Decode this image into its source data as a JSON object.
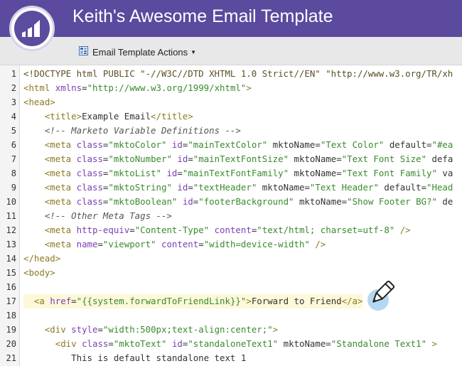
{
  "header": {
    "title": "Keith's Awesome Email Template",
    "logo_icon": "marketo-logo-icon"
  },
  "toolbar": {
    "actions_label": "Email Template Actions",
    "actions_icon": "template-grid-icon"
  },
  "editor": {
    "highlighted_line": 17,
    "lines": [
      {
        "n": "1",
        "tokens": [
          [
            "decl",
            "<!DOCTYPE html PUBLIC \"-//W3C//DTD XHTML 1.0 Strict//EN\" \"http://www.w3.org/TR/xh"
          ]
        ]
      },
      {
        "n": "2",
        "tokens": [
          [
            "tag",
            "<html "
          ],
          [
            "attr",
            "xmlns"
          ],
          [
            "txt",
            "="
          ],
          [
            "val",
            "\"http://www.w3.org/1999/xhtml\""
          ],
          [
            "tag",
            ">"
          ]
        ]
      },
      {
        "n": "3",
        "tokens": [
          [
            "tag",
            "<head>"
          ]
        ]
      },
      {
        "n": "4",
        "tokens": [
          [
            "txt",
            "    "
          ],
          [
            "tag",
            "<title>"
          ],
          [
            "txt",
            "Example Email"
          ],
          [
            "tag",
            "</title>"
          ]
        ]
      },
      {
        "n": "5",
        "tokens": [
          [
            "txt",
            "    "
          ],
          [
            "comment",
            "<!-- Marketo Variable Definitions -->"
          ]
        ]
      },
      {
        "n": "6",
        "tokens": [
          [
            "txt",
            "    "
          ],
          [
            "tag",
            "<meta "
          ],
          [
            "attr",
            "class"
          ],
          [
            "txt",
            "="
          ],
          [
            "val",
            "\"mktoColor\""
          ],
          [
            "txt",
            " "
          ],
          [
            "attr",
            "id"
          ],
          [
            "txt",
            "="
          ],
          [
            "val",
            "\"mainTextColor\""
          ],
          [
            "txt",
            " mktoName="
          ],
          [
            "val",
            "\"Text Color\""
          ],
          [
            "txt",
            " default="
          ],
          [
            "val",
            "\"#ea"
          ]
        ]
      },
      {
        "n": "7",
        "tokens": [
          [
            "txt",
            "    "
          ],
          [
            "tag",
            "<meta "
          ],
          [
            "attr",
            "class"
          ],
          [
            "txt",
            "="
          ],
          [
            "val",
            "\"mktoNumber\""
          ],
          [
            "txt",
            " "
          ],
          [
            "attr",
            "id"
          ],
          [
            "txt",
            "="
          ],
          [
            "val",
            "\"mainTextFontSize\""
          ],
          [
            "txt",
            " mktoName="
          ],
          [
            "val",
            "\"Text Font Size\""
          ],
          [
            "txt",
            " defa"
          ]
        ]
      },
      {
        "n": "8",
        "tokens": [
          [
            "txt",
            "    "
          ],
          [
            "tag",
            "<meta "
          ],
          [
            "attr",
            "class"
          ],
          [
            "txt",
            "="
          ],
          [
            "val",
            "\"mktoList\""
          ],
          [
            "txt",
            " "
          ],
          [
            "attr",
            "id"
          ],
          [
            "txt",
            "="
          ],
          [
            "val",
            "\"mainTextFontFamily\""
          ],
          [
            "txt",
            " mktoName="
          ],
          [
            "val",
            "\"Text Font Family\""
          ],
          [
            "txt",
            " va"
          ]
        ]
      },
      {
        "n": "9",
        "tokens": [
          [
            "txt",
            "    "
          ],
          [
            "tag",
            "<meta "
          ],
          [
            "attr",
            "class"
          ],
          [
            "txt",
            "="
          ],
          [
            "val",
            "\"mktoString\""
          ],
          [
            "txt",
            " "
          ],
          [
            "attr",
            "id"
          ],
          [
            "txt",
            "="
          ],
          [
            "val",
            "\"textHeader\""
          ],
          [
            "txt",
            " mktoName="
          ],
          [
            "val",
            "\"Text Header\""
          ],
          [
            "txt",
            " default="
          ],
          [
            "val",
            "\"Head"
          ]
        ]
      },
      {
        "n": "10",
        "tokens": [
          [
            "txt",
            "    "
          ],
          [
            "tag",
            "<meta "
          ],
          [
            "attr",
            "class"
          ],
          [
            "txt",
            "="
          ],
          [
            "val",
            "\"mktoBoolean\""
          ],
          [
            "txt",
            " "
          ],
          [
            "attr",
            "id"
          ],
          [
            "txt",
            "="
          ],
          [
            "val",
            "\"footerBackground\""
          ],
          [
            "txt",
            " mktoName="
          ],
          [
            "val",
            "\"Show Footer BG?\""
          ],
          [
            "txt",
            " de"
          ]
        ]
      },
      {
        "n": "11",
        "tokens": [
          [
            "txt",
            "    "
          ],
          [
            "comment",
            "<!-- Other Meta Tags -->"
          ]
        ]
      },
      {
        "n": "12",
        "tokens": [
          [
            "txt",
            "    "
          ],
          [
            "tag",
            "<meta "
          ],
          [
            "attr",
            "http-equiv"
          ],
          [
            "txt",
            "="
          ],
          [
            "val",
            "\"Content-Type\""
          ],
          [
            "txt",
            " "
          ],
          [
            "attr",
            "content"
          ],
          [
            "txt",
            "="
          ],
          [
            "val",
            "\"text/html; charset=utf-8\""
          ],
          [
            "tag",
            " />"
          ]
        ]
      },
      {
        "n": "13",
        "tokens": [
          [
            "txt",
            "    "
          ],
          [
            "tag",
            "<meta "
          ],
          [
            "attr",
            "name"
          ],
          [
            "txt",
            "="
          ],
          [
            "val",
            "\"viewport\""
          ],
          [
            "txt",
            " "
          ],
          [
            "attr",
            "content"
          ],
          [
            "txt",
            "="
          ],
          [
            "val",
            "\"width=device-width\""
          ],
          [
            "tag",
            " />"
          ]
        ]
      },
      {
        "n": "14",
        "tokens": [
          [
            "tag",
            "</head>"
          ]
        ]
      },
      {
        "n": "15",
        "tokens": [
          [
            "tag",
            "<body>"
          ]
        ]
      },
      {
        "n": "16",
        "tokens": []
      },
      {
        "n": "17",
        "tokens": [
          [
            "txt",
            "  "
          ],
          [
            "tag",
            "<a "
          ],
          [
            "attr",
            "href"
          ],
          [
            "txt",
            "="
          ],
          [
            "val",
            "\"{{system.forwardToFriendLink}}\""
          ],
          [
            "tag",
            ">"
          ],
          [
            "txt",
            "Forward to Friend"
          ],
          [
            "tag",
            "</a>"
          ]
        ]
      },
      {
        "n": "18",
        "tokens": []
      },
      {
        "n": "19",
        "tokens": [
          [
            "txt",
            "    "
          ],
          [
            "tag",
            "<div "
          ],
          [
            "attr",
            "style"
          ],
          [
            "txt",
            "="
          ],
          [
            "val",
            "\"width:500px;text-align:center;\""
          ],
          [
            "tag",
            ">"
          ]
        ]
      },
      {
        "n": "20",
        "tokens": [
          [
            "txt",
            "      "
          ],
          [
            "tag",
            "<div "
          ],
          [
            "attr",
            "class"
          ],
          [
            "txt",
            "="
          ],
          [
            "val",
            "\"mktoText\""
          ],
          [
            "txt",
            " "
          ],
          [
            "attr",
            "id"
          ],
          [
            "txt",
            "="
          ],
          [
            "val",
            "\"standaloneText1\""
          ],
          [
            "txt",
            " mktoName="
          ],
          [
            "val",
            "\"Standalone Text1\""
          ],
          [
            "tag",
            " >"
          ]
        ]
      },
      {
        "n": "21",
        "tokens": [
          [
            "txt",
            "         This is default standalone text 1"
          ]
        ]
      }
    ]
  },
  "cursor": {
    "icon": "pencil-icon"
  }
}
